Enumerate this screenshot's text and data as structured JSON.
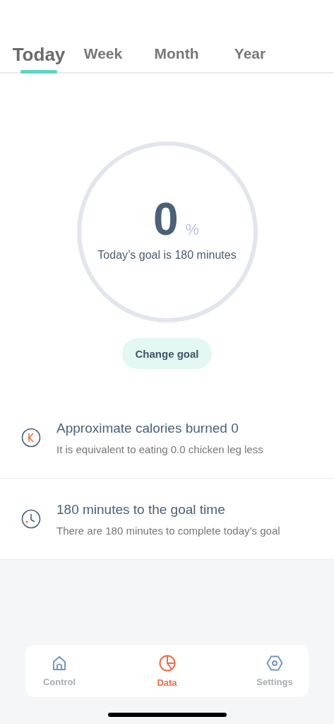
{
  "tabs": [
    {
      "label": "Today",
      "selected": true
    },
    {
      "label": "Week",
      "selected": false
    },
    {
      "label": "Month",
      "selected": false
    },
    {
      "label": "Year",
      "selected": false
    }
  ],
  "progress": {
    "value": "0",
    "unit": "%",
    "goal_text": "Today’s goal is 180 minutes"
  },
  "change_goal_button": "Change goal",
  "stats": [
    {
      "kind": "calories",
      "title": "Approximate calories burned 0",
      "subtitle": "It is equivalent to eating 0.0 chicken leg less"
    },
    {
      "kind": "clock",
      "title": "180 minutes to the goal time",
      "subtitle": "There are 180 minutes to complete today’s goal"
    }
  ],
  "nav": [
    {
      "kind": "home",
      "label": "Control",
      "selected": false
    },
    {
      "kind": "chart",
      "label": "Data",
      "selected": true
    },
    {
      "kind": "settings",
      "label": "Settings",
      "selected": false
    }
  ]
}
